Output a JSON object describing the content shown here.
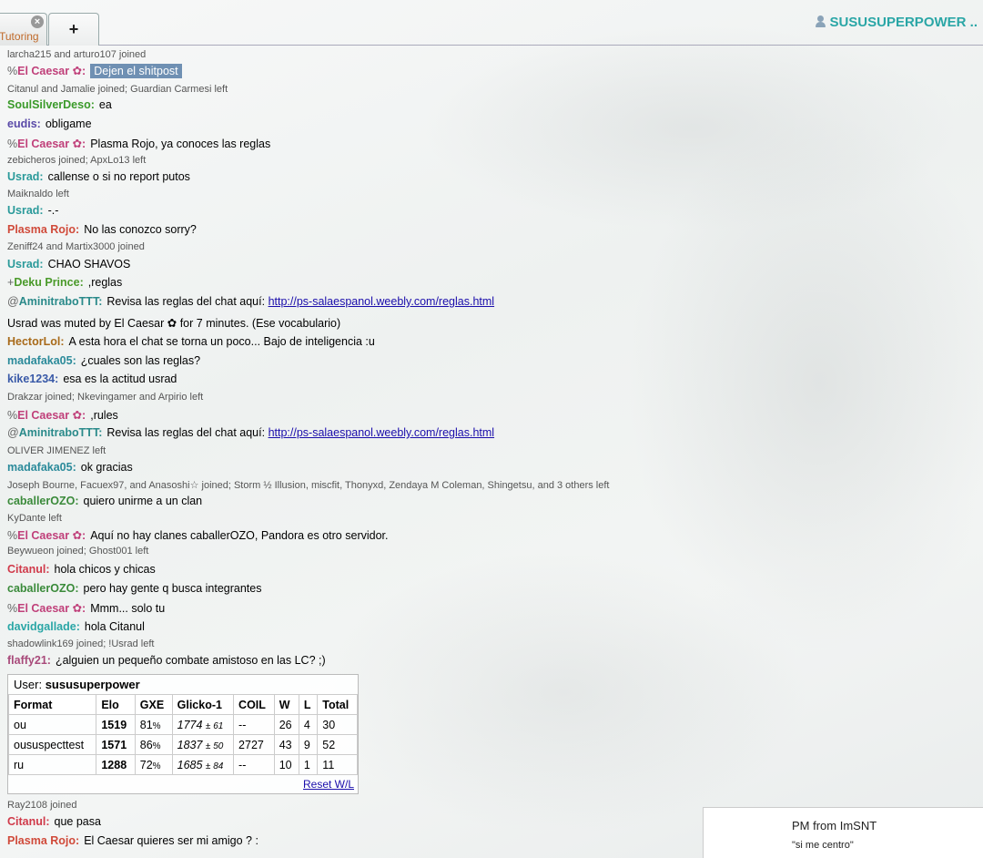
{
  "header": {
    "room_tab_label": "Tutoring",
    "close_glyph": "×",
    "add_tab_glyph": "+",
    "username": "SUSUSUPERPOWER",
    "user_menu_glyph": ".."
  },
  "chat": [
    {
      "kind": "notice",
      "text": "larcha215 and arturo107 joined"
    },
    {
      "kind": "msg",
      "group": "%",
      "name": "El Caesar ✿:",
      "color": "#c0407a",
      "text": "Dejen el shitpost",
      "highlight": true
    },
    {
      "kind": "notice",
      "text": "Citanul and Jamalie joined; Guardian Carmesi left"
    },
    {
      "kind": "msg",
      "group": "",
      "name": "SoulSilverDeso:",
      "color": "#3a9a2a",
      "text": "ea"
    },
    {
      "kind": "msg",
      "group": "",
      "name": "eudis:",
      "color": "#5a4aa8",
      "text": "obligame"
    },
    {
      "kind": "msg",
      "group": "%",
      "name": "El Caesar ✿:",
      "color": "#c0407a",
      "text": "Plasma Rojo, ya conoces las reglas"
    },
    {
      "kind": "notice",
      "text": "zebicheros joined; ApxLo13 left"
    },
    {
      "kind": "msg",
      "group": "",
      "name": "Usrad:",
      "color": "#2a9a9a",
      "text": "callense o si no report putos"
    },
    {
      "kind": "notice",
      "text": "Maiknaldo left"
    },
    {
      "kind": "msg",
      "group": "",
      "name": "Usrad:",
      "color": "#2a9a9a",
      "text": "-.-"
    },
    {
      "kind": "msg",
      "group": "",
      "name": "Plasma Rojo:",
      "color": "#d04a3a",
      "text": "No las conozco sorry?"
    },
    {
      "kind": "notice",
      "text": "Zeniff24 and Martix3000 joined"
    },
    {
      "kind": "msg",
      "group": "",
      "name": "Usrad:",
      "color": "#2a9a9a",
      "text": "CHAO SHAVOS"
    },
    {
      "kind": "msg",
      "group": "+",
      "name": "Deku Prince:",
      "color": "#4a9a2a",
      "text": ",reglas"
    },
    {
      "kind": "msg",
      "group": "@",
      "name": "AminitraboTTT:",
      "color": "#2a8a8a",
      "text": "Revisa las reglas del chat aquí: ",
      "link": "http://ps-salaespanol.weebly.com/reglas.html"
    },
    {
      "kind": "plain",
      "text": "Usrad was muted by El Caesar ✿ for 7 minutes. (Ese vocabulario)"
    },
    {
      "kind": "msg",
      "group": "",
      "name": "HectorLol:",
      "color": "#a86a1a",
      "text": "A esta hora el chat se torna un poco... Bajo de inteligencia :u"
    },
    {
      "kind": "msg",
      "group": "",
      "name": "madafaka05:",
      "color": "#2a8a9a",
      "text": "¿cuales son las reglas?"
    },
    {
      "kind": "msg",
      "group": "",
      "name": "kike1234:",
      "color": "#3a5aa8",
      "text": "esa es la actitud usrad"
    },
    {
      "kind": "notice",
      "text": "Drakzar joined; Nkevingamer and Arpirio left"
    },
    {
      "kind": "msg",
      "group": "%",
      "name": "El Caesar ✿:",
      "color": "#c0407a",
      "text": ",rules"
    },
    {
      "kind": "msg",
      "group": "@",
      "name": "AminitraboTTT:",
      "color": "#2a8a8a",
      "text": "Revisa las reglas del chat aquí: ",
      "link": "http://ps-salaespanol.weebly.com/reglas.html"
    },
    {
      "kind": "notice",
      "text": "OLIVER JIMENEZ left"
    },
    {
      "kind": "msg",
      "group": "",
      "name": "madafaka05:",
      "color": "#2a8a9a",
      "text": "ok gracias"
    },
    {
      "kind": "notice",
      "text": "Joseph Bourne, Facuex97, and Anasoshi☆ joined; Storm ½ Illusion, miscfit, Thonyxd, Zendaya M Coleman, Shingetsu, and 3 others left"
    },
    {
      "kind": "msg",
      "group": "",
      "name": "caballerOZO:",
      "color": "#3a8a3a",
      "text": "quiero unirme a un clan"
    },
    {
      "kind": "notice",
      "text": "KyDante left"
    },
    {
      "kind": "msg",
      "group": "%",
      "name": "El Caesar ✿:",
      "color": "#c0407a",
      "text": "Aquí no hay clanes caballerOZO, Pandora es otro servidor."
    },
    {
      "kind": "notice",
      "text": "Beywueon joined; Ghost001 left"
    },
    {
      "kind": "msg",
      "group": "",
      "name": "Citanul:",
      "color": "#d03a4a",
      "text": "hola chicos y chicas"
    },
    {
      "kind": "msg",
      "group": "",
      "name": "caballerOZO:",
      "color": "#3a8a3a",
      "text": "pero hay gente q busca integrantes"
    },
    {
      "kind": "msg",
      "group": "%",
      "name": "El Caesar ✿:",
      "color": "#c0407a",
      "text": "Mmm... solo tu"
    },
    {
      "kind": "msg",
      "group": "",
      "name": "davidgallade:",
      "color": "#2aa6a6",
      "text": "hola Citanul"
    },
    {
      "kind": "notice",
      "text": "shadowlink169 joined; !Usrad left"
    },
    {
      "kind": "msg",
      "group": "",
      "name": "flaffy21:",
      "color": "#a84a7a",
      "text": "¿alguien un pequeño combate amistoso en las LC? ;)"
    }
  ],
  "ranks": {
    "user_label": "User:",
    "user_name": "sususuperpower",
    "columns": [
      "Format",
      "Elo",
      "GXE",
      "Glicko-1",
      "COIL",
      "W",
      "L",
      "Total"
    ],
    "rows": [
      {
        "format": "ou",
        "elo": "1519",
        "gxe": "81",
        "pct": "%",
        "glicko": "1774",
        "pm": "± 61",
        "coil": "--",
        "w": "26",
        "l": "4",
        "total": "30"
      },
      {
        "format": "oususpecttest",
        "elo": "1571",
        "gxe": "86",
        "pct": "%",
        "glicko": "1837",
        "pm": "± 50",
        "coil": "2727",
        "w": "43",
        "l": "9",
        "total": "52"
      },
      {
        "format": "ru",
        "elo": "1288",
        "gxe": "72",
        "pct": "%",
        "glicko": "1685",
        "pm": "± 84",
        "coil": "--",
        "w": "10",
        "l": "1",
        "total": "11"
      }
    ],
    "reset_label": "Reset W/L"
  },
  "after": [
    {
      "kind": "notice",
      "text": "Ray2108 joined"
    },
    {
      "kind": "msg",
      "group": "",
      "name": "Citanul:",
      "color": "#d03a4a",
      "text": "que pasa"
    },
    {
      "kind": "msg",
      "group": "",
      "name": "Plasma Rojo:",
      "color": "#d04a3a",
      "text": "El Caesar quieres ser mi amigo ? :"
    }
  ],
  "pm": {
    "title": "PM from  ImSNT",
    "body": "\"si me centro\""
  }
}
